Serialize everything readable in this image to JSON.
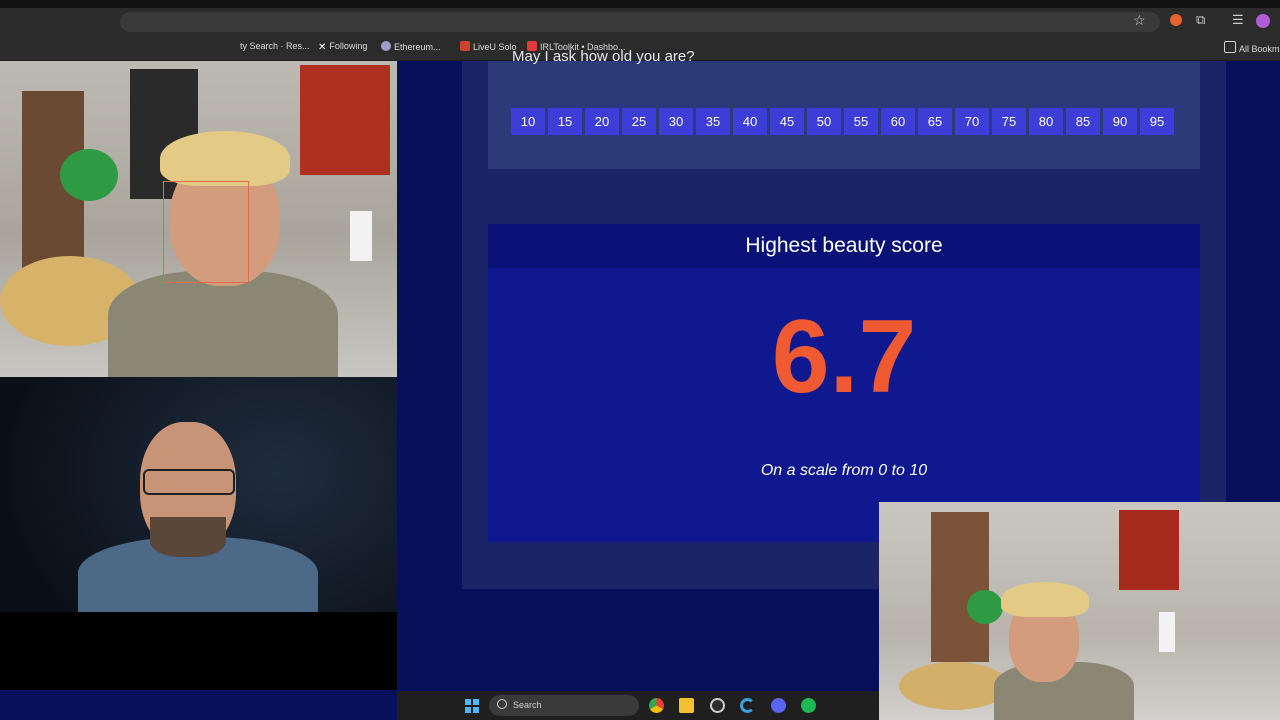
{
  "browser": {
    "bookmarks": [
      {
        "label": "ty Search · Res...",
        "icon": "bookmark-icon",
        "color": "#7d7d7d"
      },
      {
        "label": "Following",
        "icon": "x-logo-icon",
        "color": "#ffffff"
      },
      {
        "label": "Ethereum...",
        "icon": "ethereum-icon",
        "color": "#9aa0c8"
      },
      {
        "label": "LiveU Solo",
        "icon": "liveu-icon",
        "color": "#d04030"
      },
      {
        "label": "IRLToolkit • Dashbo...",
        "icon": "irltoolkit-icon",
        "color": "#e03a3a"
      }
    ],
    "all_bookmarks": "All Bookm"
  },
  "quiz": {
    "question_partial": "May I ask how old you are?",
    "ages": [
      "10",
      "15",
      "20",
      "25",
      "30",
      "35",
      "40",
      "45",
      "50",
      "55",
      "60",
      "65",
      "70",
      "75",
      "80",
      "85",
      "90",
      "95"
    ]
  },
  "score": {
    "title": "Highest beauty score",
    "value": "6.7",
    "scale": "On a scale from 0 to 10",
    "value_color": "#ef5a33"
  },
  "taskbar": {
    "search_label": "Search",
    "apps": [
      "chrome-icon",
      "file-explorer-icon",
      "obs-icon",
      "ccleaner-icon",
      "discord-icon",
      "spotify-icon"
    ]
  }
}
